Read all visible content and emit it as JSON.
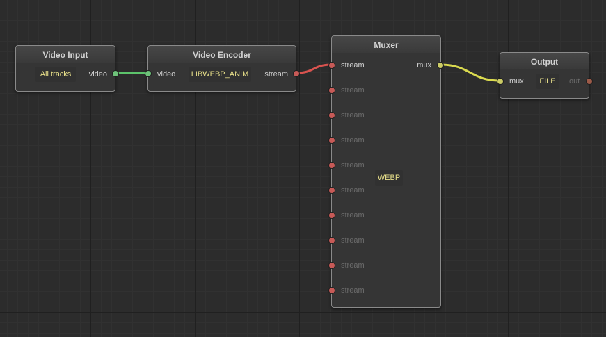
{
  "nodes": {
    "video_input": {
      "title": "Video Input",
      "value": "All tracks",
      "output_label": "video"
    },
    "video_encoder": {
      "title": "Video Encoder",
      "input_label": "video",
      "value": "LIBWEBP_ANIM",
      "output_label": "stream"
    },
    "muxer": {
      "title": "Muxer",
      "value": "WEBP",
      "output_label": "mux",
      "inputs": [
        "stream",
        "stream",
        "stream",
        "stream",
        "stream",
        "stream",
        "stream",
        "stream",
        "stream",
        "stream"
      ]
    },
    "output": {
      "title": "Output",
      "input_label": "mux",
      "value": "FILE",
      "output_label": "out"
    }
  },
  "colors": {
    "video_wire": "#5cc36b",
    "stream_wire": "#d9534f",
    "mux_wire": "#dada4f",
    "canvas_bg": "#2c2c2c"
  }
}
